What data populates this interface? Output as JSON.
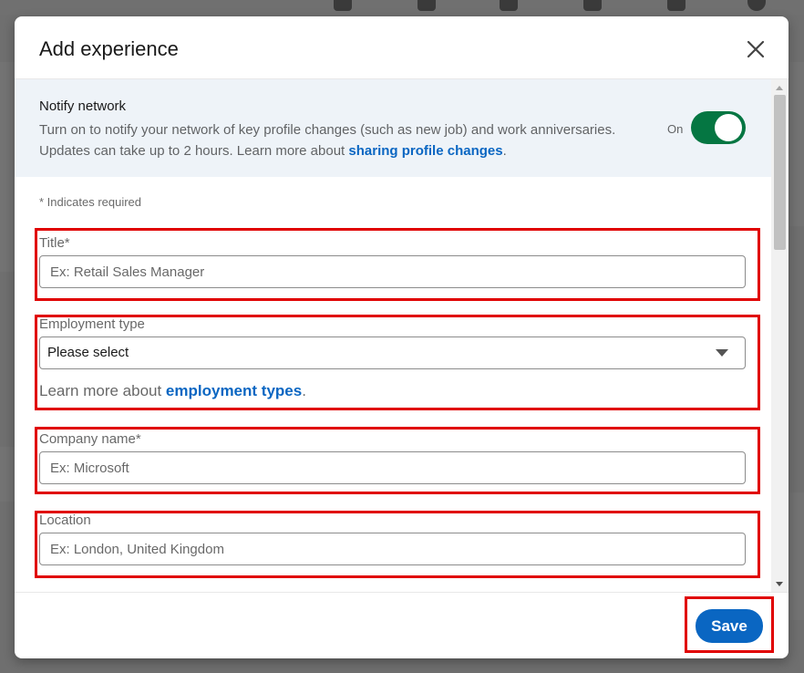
{
  "dialog": {
    "title": "Add experience",
    "close_icon": "close-icon"
  },
  "notify": {
    "title": "Notify network",
    "text": "Turn on to notify your network of key profile changes (such as new job) and work anniversaries. Updates can take up to 2 hours. Learn more about ",
    "link": "sharing profile changes",
    "after_link": ".",
    "toggle_label": "On",
    "toggle_on": true,
    "toggle_color": "#057642"
  },
  "form": {
    "required_note": "* Indicates required",
    "title": {
      "label": "Title*",
      "placeholder": "Ex: Retail Sales Manager"
    },
    "employment_type": {
      "label": "Employment type",
      "selected": "Please select",
      "learn_prefix": "Learn more about ",
      "learn_link": "employment types",
      "learn_suffix": "."
    },
    "company": {
      "label": "Company name*",
      "placeholder": "Ex: Microsoft"
    },
    "location": {
      "label": "Location",
      "placeholder": "Ex: London, United Kingdom"
    }
  },
  "footer": {
    "save_label": "Save",
    "accent": "#0a66c2"
  },
  "highlight_color": "#e00000"
}
